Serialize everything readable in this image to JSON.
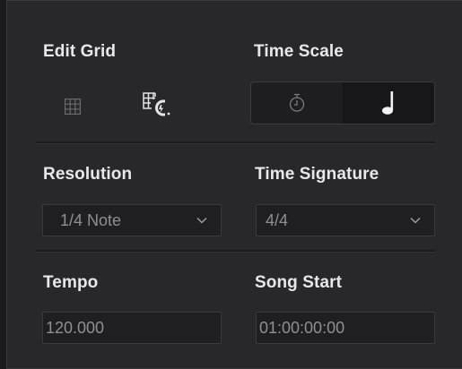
{
  "edit_grid": {
    "title": "Edit Grid",
    "grid_icon": "grid-icon",
    "grid_snap_icon": "grid-snap-icon"
  },
  "time_scale": {
    "title": "Time Scale",
    "stopwatch_icon": "stopwatch-icon",
    "note_icon": "quarter-note-icon",
    "selected": "note"
  },
  "resolution": {
    "title": "Resolution",
    "value": "1/4 Note"
  },
  "time_signature": {
    "title": "Time Signature",
    "value": "4/4"
  },
  "tempo": {
    "title": "Tempo",
    "value": "120.000"
  },
  "song_start": {
    "title": "Song Start",
    "value": "01:00:00:00"
  },
  "colors": {
    "panel_bg": "#28282b",
    "field_bg": "#1f1f22",
    "label_text": "#e8e8ea",
    "value_text": "#8f8f94"
  }
}
